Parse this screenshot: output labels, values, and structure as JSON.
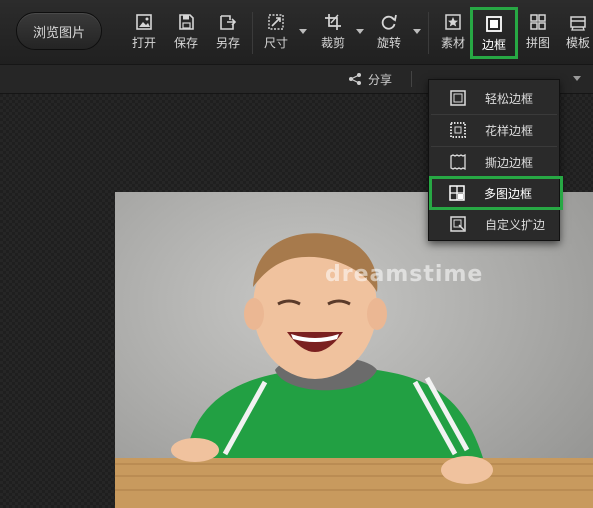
{
  "toolbar": {
    "browse_label": "浏览图片",
    "tools": {
      "open": "打开",
      "save": "保存",
      "save_as": "另存",
      "size": "尺寸",
      "crop": "裁剪",
      "rotate": "旋转",
      "material": "素材",
      "border": "边框",
      "collage": "拼图",
      "template": "模板"
    }
  },
  "subbar": {
    "share_label": "分享"
  },
  "border_menu": {
    "items": [
      {
        "label": "轻松边框",
        "icon": "simple-frame-icon"
      },
      {
        "label": "花样边框",
        "icon": "pattern-frame-icon"
      },
      {
        "label": "撕边边框",
        "icon": "torn-edge-frame-icon"
      },
      {
        "label": "多图边框",
        "icon": "multi-image-frame-icon",
        "highlighted": true
      },
      {
        "label": "自定义扩边",
        "icon": "custom-extend-icon"
      }
    ]
  },
  "photo": {
    "watermark": "dreamstime"
  },
  "colors": {
    "highlight": "#27a844",
    "toolbar_bg": "#242424"
  }
}
